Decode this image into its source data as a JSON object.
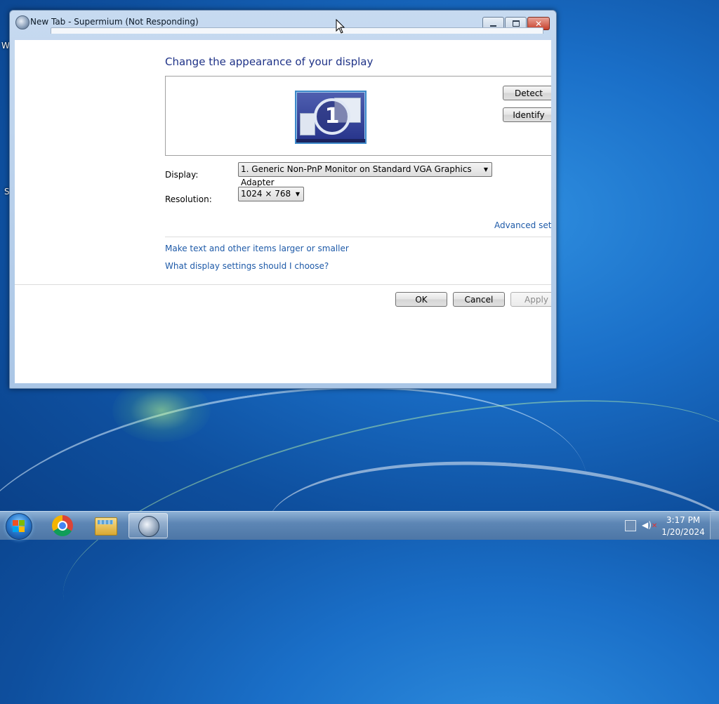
{
  "desktop": {
    "edge_letter_1": "W",
    "edge_letter_2": "S"
  },
  "window": {
    "title": "New Tab - Supermium (Not Responding)",
    "close_glyph": "✕"
  },
  "display_settings": {
    "heading": "Change the appearance of your display",
    "monitor_number": "1",
    "detect_label": "Detect",
    "identify_label": "Identify",
    "display_label": "Display:",
    "display_value": "1. Generic Non-PnP Monitor on Standard VGA Graphics Adapter",
    "resolution_label": "Resolution:",
    "resolution_value": "1024 × 768",
    "advanced_link": "Advanced settings",
    "text_size_link": "Make text and other items larger or smaller",
    "help_link": "What display settings should I choose?",
    "ok_label": "OK",
    "cancel_label": "Cancel",
    "apply_label": "Apply"
  },
  "taskbar": {
    "time": "3:17 PM",
    "date": "1/20/2024",
    "mute_mark": "✕"
  },
  "colors": {
    "link": "#1e5aa8",
    "heading": "#1e3287"
  }
}
